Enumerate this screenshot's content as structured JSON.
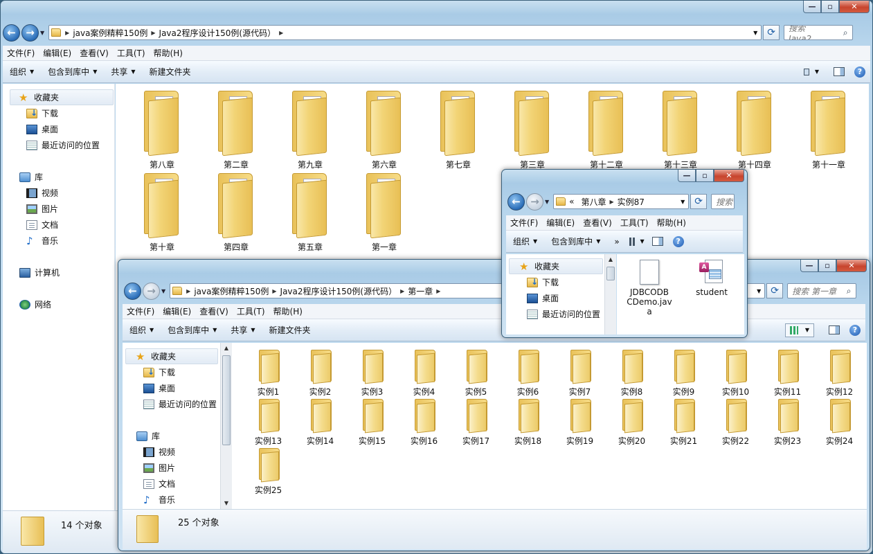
{
  "back_window": {
    "address": [
      "java案例精粹150例",
      "Java2程序设计150例(源代码）"
    ],
    "search_placeholder": "搜索 Java2...",
    "menu": [
      "文件(F)",
      "编辑(E)",
      "查看(V)",
      "工具(T)",
      "帮助(H)"
    ],
    "commands": [
      "组织",
      "包含到库中",
      "共享",
      "新建文件夹"
    ],
    "nav": {
      "favorites": "收藏夹",
      "downloads": "下载",
      "desktop": "桌面",
      "recent": "最近访问的位置",
      "libraries": "库",
      "videos": "视频",
      "pictures": "图片",
      "documents": "文档",
      "music": "音乐",
      "computer": "计算机",
      "network": "网络"
    },
    "folders_row1": [
      "第八章",
      "第二章",
      "第九章",
      "第六章",
      "第七章",
      "第三章",
      "第十二章",
      "第十三章",
      "第十四章",
      "第十一章"
    ],
    "folders_row2": [
      "第十章",
      "第四章",
      "第五章",
      "第一章"
    ],
    "status": "14 个对象"
  },
  "front_window": {
    "address": [
      "java案例精粹150例",
      "Java2程序设计150例(源代码）",
      "第一章"
    ],
    "search_placeholder": "搜索 第一章",
    "menu": [
      "文件(F)",
      "编辑(E)",
      "查看(V)",
      "工具(T)",
      "帮助(H)"
    ],
    "commands": [
      "组织",
      "包含到库中",
      "共享",
      "新建文件夹"
    ],
    "nav": {
      "favorites": "收藏夹",
      "downloads": "下载",
      "desktop": "桌面",
      "recent": "最近访问的位置",
      "libraries": "库",
      "videos": "视频",
      "pictures": "图片",
      "documents": "文档",
      "music": "音乐"
    },
    "folders": [
      "实例1",
      "实例2",
      "实例3",
      "实例4",
      "实例5",
      "实例6",
      "实例7",
      "实例8",
      "实例9",
      "实例10",
      "实例11",
      "实例12",
      "实例13",
      "实例14",
      "实例15",
      "实例16",
      "实例17",
      "实例18",
      "实例19",
      "实例20",
      "实例21",
      "实例22",
      "实例23",
      "实例24",
      "实例25"
    ],
    "status": "25 个对象"
  },
  "small_window": {
    "address_prefix": "«",
    "address": [
      "第八章",
      "实例87"
    ],
    "search_placeholder": "搜索",
    "menu": [
      "文件(F)",
      "编辑(E)",
      "查看(V)",
      "工具(T)",
      "帮助(H)"
    ],
    "commands": [
      "组织",
      "包含到库中",
      "»"
    ],
    "nav": {
      "favorites": "收藏夹",
      "downloads": "下载",
      "desktop": "桌面",
      "recent": "最近访问的位置"
    },
    "files": [
      {
        "name": "JDBCODBCDemo.java",
        "lines": [
          "JDBCODB",
          "CDemo.jav",
          "a"
        ],
        "icon": "blank-file-icon"
      },
      {
        "name": "student",
        "lines": [
          "student"
        ],
        "icon": "access-database-icon"
      }
    ]
  }
}
